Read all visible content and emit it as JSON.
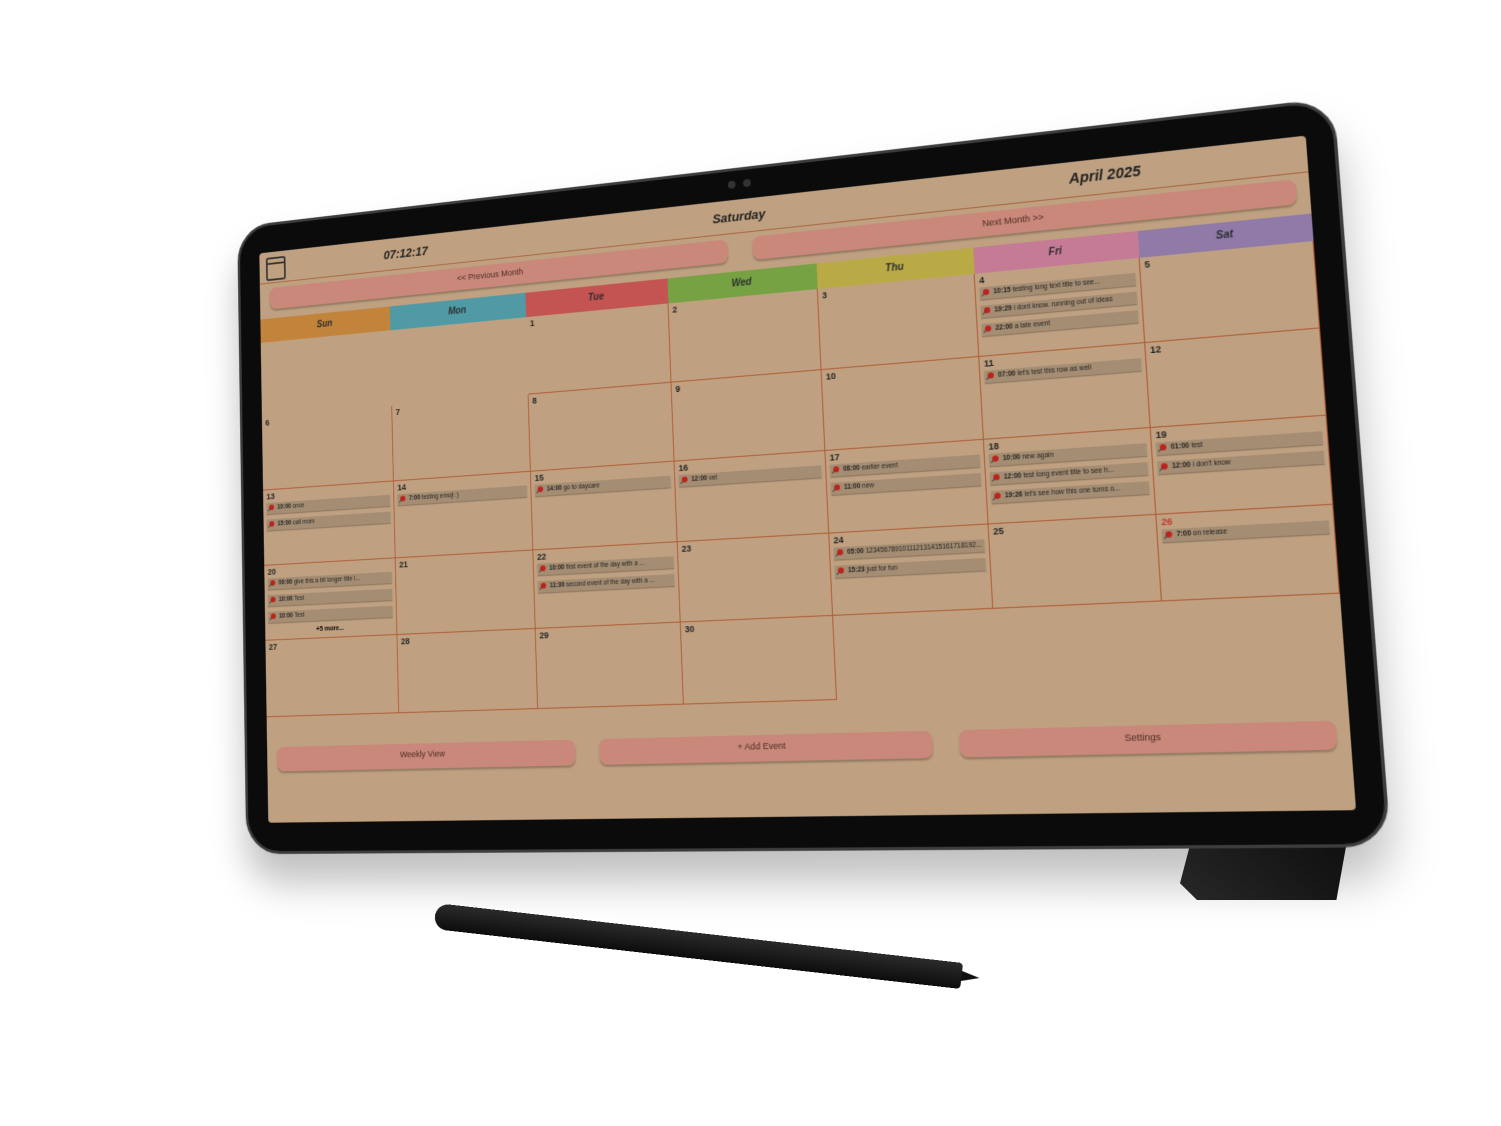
{
  "header": {
    "clock": "07:12:17",
    "day_name": "Saturday",
    "month_year": "April 2025"
  },
  "nav": {
    "prev_label": "<< Previous Month",
    "next_label": "Next Month >>"
  },
  "weekdays": [
    {
      "label": "Sun",
      "color": "#c2833a"
    },
    {
      "label": "Mon",
      "color": "#4f9aa5"
    },
    {
      "label": "Tue",
      "color": "#c35452"
    },
    {
      "label": "Wed",
      "color": "#76a244"
    },
    {
      "label": "Thu",
      "color": "#b9aa45"
    },
    {
      "label": "Fri",
      "color": "#c57a95"
    },
    {
      "label": "Sat",
      "color": "#8f7aa8"
    }
  ],
  "days": [
    {
      "day": "",
      "events": []
    },
    {
      "day": "",
      "events": []
    },
    {
      "day": "1",
      "events": []
    },
    {
      "day": "2",
      "events": []
    },
    {
      "day": "3",
      "events": []
    },
    {
      "day": "4",
      "events": [
        {
          "time": "10:15",
          "title": "testing long text title to see..."
        },
        {
          "time": "19:29",
          "title": "i dont know. running out of ideas"
        },
        {
          "time": "22:00",
          "title": "a late event"
        }
      ]
    },
    {
      "day": "5",
      "events": []
    },
    {
      "day": "6",
      "events": []
    },
    {
      "day": "7",
      "events": []
    },
    {
      "day": "8",
      "events": []
    },
    {
      "day": "9",
      "events": []
    },
    {
      "day": "10",
      "events": []
    },
    {
      "day": "11",
      "events": [
        {
          "time": "07:00",
          "title": "let's test this row as well"
        }
      ]
    },
    {
      "day": "12",
      "events": []
    },
    {
      "day": "13",
      "events": [
        {
          "time": "10:00",
          "title": "once"
        },
        {
          "time": "15:00",
          "title": "call mom"
        }
      ]
    },
    {
      "day": "14",
      "events": [
        {
          "time": "7:00",
          "title": "testing emoji :)"
        }
      ]
    },
    {
      "day": "15",
      "events": [
        {
          "time": "14:00",
          "title": "go to daycare"
        }
      ]
    },
    {
      "day": "16",
      "events": [
        {
          "time": "12:00",
          "title": "vet"
        }
      ]
    },
    {
      "day": "17",
      "events": [
        {
          "time": "08:00",
          "title": "earlier event"
        },
        {
          "time": "11:00",
          "title": "new"
        }
      ]
    },
    {
      "day": "18",
      "events": [
        {
          "time": "10:00",
          "title": "new again"
        },
        {
          "time": "12:00",
          "title": "test long event title to see h..."
        },
        {
          "time": "19:26",
          "title": "let's see how this one turns o..."
        }
      ]
    },
    {
      "day": "19",
      "events": [
        {
          "time": "01:00",
          "title": "test"
        },
        {
          "time": "12:00",
          "title": "i don't know"
        }
      ]
    },
    {
      "day": "20",
      "events": [
        {
          "time": "09:00",
          "title": "give this a bit longer title l..."
        },
        {
          "time": "10:00",
          "title": "Test"
        },
        {
          "time": "10:00",
          "title": "Test"
        }
      ],
      "more": "+5 more..."
    },
    {
      "day": "21",
      "events": []
    },
    {
      "day": "22",
      "events": [
        {
          "time": "10:00",
          "title": "first event of the day with a ..."
        },
        {
          "time": "11:30",
          "title": "second event of the day with a ..."
        }
      ]
    },
    {
      "day": "23",
      "events": []
    },
    {
      "day": "24",
      "events": [
        {
          "time": "05:00",
          "title": "123456789101112131415161718192..."
        },
        {
          "time": "15:23",
          "title": "just for fun"
        }
      ]
    },
    {
      "day": "25",
      "events": []
    },
    {
      "day": "26",
      "today": true,
      "events": [
        {
          "time": "7:00",
          "title": "on release"
        }
      ]
    },
    {
      "day": "27",
      "events": []
    },
    {
      "day": "28",
      "events": []
    },
    {
      "day": "29",
      "events": []
    },
    {
      "day": "30",
      "events": []
    },
    {
      "day": "",
      "events": []
    },
    {
      "day": "",
      "events": []
    },
    {
      "day": "",
      "events": []
    }
  ],
  "bottom": {
    "weekly_label": "Weekly View",
    "add_label": "+ Add Event",
    "settings_label": "Settings"
  }
}
